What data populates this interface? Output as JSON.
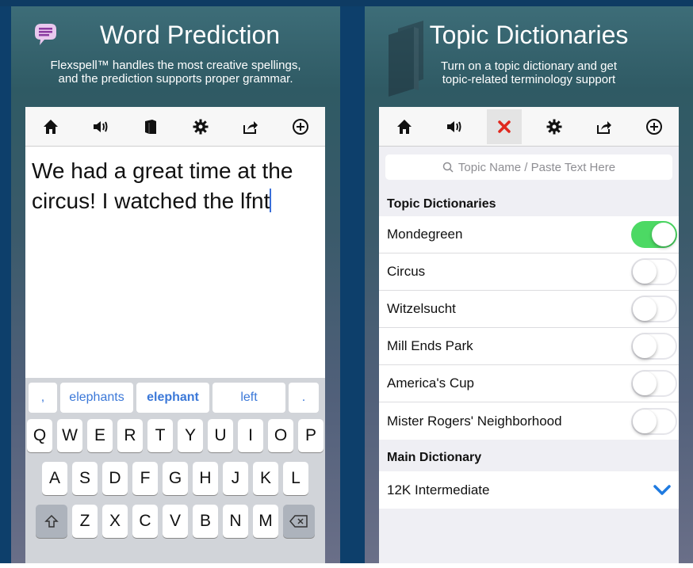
{
  "colors": {
    "accent": "#3b78d8",
    "toggle_on": "#4cd964",
    "close_red": "#e0281e",
    "chevron_blue": "#1f7ae0"
  },
  "left_panel": {
    "title": "Word Prediction",
    "subtitle_line1": "Flexspell™ handles the most creative spellings,",
    "subtitle_line2": "and the prediction supports proper grammar.",
    "toolbar_icons": [
      "home-icon",
      "speaker-icon",
      "book-icon",
      "gear-icon",
      "share-icon",
      "add-circle-icon"
    ],
    "editor_text": "We had a great time at the circus! I watched the lfnt",
    "predictions": [
      ",",
      "elephants",
      "elephant",
      "left",
      "."
    ],
    "keyboard": {
      "row1": [
        "Q",
        "W",
        "E",
        "R",
        "T",
        "Y",
        "U",
        "I",
        "O",
        "P"
      ],
      "row2": [
        "A",
        "S",
        "D",
        "F",
        "G",
        "H",
        "J",
        "K",
        "L"
      ],
      "row3": [
        "Z",
        "X",
        "C",
        "V",
        "B",
        "N",
        "M"
      ],
      "shift_icon": "shift-icon",
      "delete_icon": "delete-icon"
    }
  },
  "right_panel": {
    "title": "Topic Dictionaries",
    "subtitle_line1": "Turn on a topic dictionary and get",
    "subtitle_line2": "topic-related terminology support",
    "toolbar_icons": [
      "home-icon",
      "speaker-icon",
      "close-icon",
      "gear-icon",
      "share-icon",
      "add-circle-icon"
    ],
    "search_placeholder": "Topic Name / Paste Text Here",
    "topic_header": "Topic Dictionaries",
    "topics": [
      {
        "name": "Mondegreen",
        "enabled": true
      },
      {
        "name": "Circus",
        "enabled": false
      },
      {
        "name": "Witzelsucht",
        "enabled": false
      },
      {
        "name": "Mill Ends Park",
        "enabled": false
      },
      {
        "name": "America's Cup",
        "enabled": false
      },
      {
        "name": "Mister Rogers' Neighborhood",
        "enabled": false
      }
    ],
    "main_header": "Main Dictionary",
    "main_dictionary": "12K Intermediate"
  }
}
